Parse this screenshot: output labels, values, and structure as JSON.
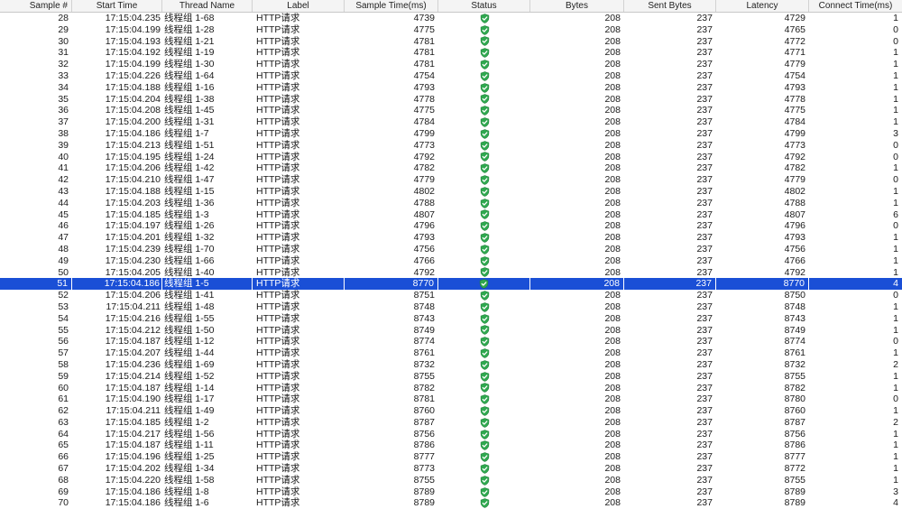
{
  "columns": {
    "sample": "Sample #",
    "start_time": "Start Time",
    "thread_name": "Thread Name",
    "label": "Label",
    "sample_time": "Sample Time(ms)",
    "status": "Status",
    "bytes": "Bytes",
    "sent_bytes": "Sent Bytes",
    "latency": "Latency",
    "connect_time": "Connect Time(ms)"
  },
  "status_icon": "success-shield-icon",
  "colors": {
    "selection": "#1a4fd6",
    "status_green": "#2fa84f"
  },
  "selected_sample": "51",
  "rows": [
    {
      "sample": "28",
      "start": "17:15:04.235",
      "thread": "线程组 1-68",
      "label": "HTTP请求",
      "time": "4739",
      "bytes": "208",
      "sent": "237",
      "latency": "4729",
      "connect": "1"
    },
    {
      "sample": "29",
      "start": "17:15:04.199",
      "thread": "线程组 1-28",
      "label": "HTTP请求",
      "time": "4775",
      "bytes": "208",
      "sent": "237",
      "latency": "4765",
      "connect": "0"
    },
    {
      "sample": "30",
      "start": "17:15:04.193",
      "thread": "线程组 1-21",
      "label": "HTTP请求",
      "time": "4781",
      "bytes": "208",
      "sent": "237",
      "latency": "4772",
      "connect": "0"
    },
    {
      "sample": "31",
      "start": "17:15:04.192",
      "thread": "线程组 1-19",
      "label": "HTTP请求",
      "time": "4781",
      "bytes": "208",
      "sent": "237",
      "latency": "4771",
      "connect": "1"
    },
    {
      "sample": "32",
      "start": "17:15:04.199",
      "thread": "线程组 1-30",
      "label": "HTTP请求",
      "time": "4781",
      "bytes": "208",
      "sent": "237",
      "latency": "4779",
      "connect": "1"
    },
    {
      "sample": "33",
      "start": "17:15:04.226",
      "thread": "线程组 1-64",
      "label": "HTTP请求",
      "time": "4754",
      "bytes": "208",
      "sent": "237",
      "latency": "4754",
      "connect": "1"
    },
    {
      "sample": "34",
      "start": "17:15:04.188",
      "thread": "线程组 1-16",
      "label": "HTTP请求",
      "time": "4793",
      "bytes": "208",
      "sent": "237",
      "latency": "4793",
      "connect": "1"
    },
    {
      "sample": "35",
      "start": "17:15:04.204",
      "thread": "线程组 1-38",
      "label": "HTTP请求",
      "time": "4778",
      "bytes": "208",
      "sent": "237",
      "latency": "4778",
      "connect": "1"
    },
    {
      "sample": "36",
      "start": "17:15:04.208",
      "thread": "线程组 1-45",
      "label": "HTTP请求",
      "time": "4775",
      "bytes": "208",
      "sent": "237",
      "latency": "4775",
      "connect": "1"
    },
    {
      "sample": "37",
      "start": "17:15:04.200",
      "thread": "线程组 1-31",
      "label": "HTTP请求",
      "time": "4784",
      "bytes": "208",
      "sent": "237",
      "latency": "4784",
      "connect": "1"
    },
    {
      "sample": "38",
      "start": "17:15:04.186",
      "thread": "线程组 1-7",
      "label": "HTTP请求",
      "time": "4799",
      "bytes": "208",
      "sent": "237",
      "latency": "4799",
      "connect": "3"
    },
    {
      "sample": "39",
      "start": "17:15:04.213",
      "thread": "线程组 1-51",
      "label": "HTTP请求",
      "time": "4773",
      "bytes": "208",
      "sent": "237",
      "latency": "4773",
      "connect": "0"
    },
    {
      "sample": "40",
      "start": "17:15:04.195",
      "thread": "线程组 1-24",
      "label": "HTTP请求",
      "time": "4792",
      "bytes": "208",
      "sent": "237",
      "latency": "4792",
      "connect": "0"
    },
    {
      "sample": "41",
      "start": "17:15:04.206",
      "thread": "线程组 1-42",
      "label": "HTTP请求",
      "time": "4782",
      "bytes": "208",
      "sent": "237",
      "latency": "4782",
      "connect": "1"
    },
    {
      "sample": "42",
      "start": "17:15:04.210",
      "thread": "线程组 1-47",
      "label": "HTTP请求",
      "time": "4779",
      "bytes": "208",
      "sent": "237",
      "latency": "4779",
      "connect": "0"
    },
    {
      "sample": "43",
      "start": "17:15:04.188",
      "thread": "线程组 1-15",
      "label": "HTTP请求",
      "time": "4802",
      "bytes": "208",
      "sent": "237",
      "latency": "4802",
      "connect": "1"
    },
    {
      "sample": "44",
      "start": "17:15:04.203",
      "thread": "线程组 1-36",
      "label": "HTTP请求",
      "time": "4788",
      "bytes": "208",
      "sent": "237",
      "latency": "4788",
      "connect": "1"
    },
    {
      "sample": "45",
      "start": "17:15:04.185",
      "thread": "线程组 1-3",
      "label": "HTTP请求",
      "time": "4807",
      "bytes": "208",
      "sent": "237",
      "latency": "4807",
      "connect": "6"
    },
    {
      "sample": "46",
      "start": "17:15:04.197",
      "thread": "线程组 1-26",
      "label": "HTTP请求",
      "time": "4796",
      "bytes": "208",
      "sent": "237",
      "latency": "4796",
      "connect": "0"
    },
    {
      "sample": "47",
      "start": "17:15:04.201",
      "thread": "线程组 1-32",
      "label": "HTTP请求",
      "time": "4793",
      "bytes": "208",
      "sent": "237",
      "latency": "4793",
      "connect": "1"
    },
    {
      "sample": "48",
      "start": "17:15:04.239",
      "thread": "线程组 1-70",
      "label": "HTTP请求",
      "time": "4756",
      "bytes": "208",
      "sent": "237",
      "latency": "4756",
      "connect": "1"
    },
    {
      "sample": "49",
      "start": "17:15:04.230",
      "thread": "线程组 1-66",
      "label": "HTTP请求",
      "time": "4766",
      "bytes": "208",
      "sent": "237",
      "latency": "4766",
      "connect": "1"
    },
    {
      "sample": "50",
      "start": "17:15:04.205",
      "thread": "线程组 1-40",
      "label": "HTTP请求",
      "time": "4792",
      "bytes": "208",
      "sent": "237",
      "latency": "4792",
      "connect": "1"
    },
    {
      "sample": "51",
      "start": "17:15:04.186",
      "thread": "线程组 1-5",
      "label": "HTTP请求",
      "time": "8770",
      "bytes": "208",
      "sent": "237",
      "latency": "8770",
      "connect": "4"
    },
    {
      "sample": "52",
      "start": "17:15:04.206",
      "thread": "线程组 1-41",
      "label": "HTTP请求",
      "time": "8751",
      "bytes": "208",
      "sent": "237",
      "latency": "8750",
      "connect": "0"
    },
    {
      "sample": "53",
      "start": "17:15:04.211",
      "thread": "线程组 1-48",
      "label": "HTTP请求",
      "time": "8748",
      "bytes": "208",
      "sent": "237",
      "latency": "8748",
      "connect": "1"
    },
    {
      "sample": "54",
      "start": "17:15:04.216",
      "thread": "线程组 1-55",
      "label": "HTTP请求",
      "time": "8743",
      "bytes": "208",
      "sent": "237",
      "latency": "8743",
      "connect": "1"
    },
    {
      "sample": "55",
      "start": "17:15:04.212",
      "thread": "线程组 1-50",
      "label": "HTTP请求",
      "time": "8749",
      "bytes": "208",
      "sent": "237",
      "latency": "8749",
      "connect": "1"
    },
    {
      "sample": "56",
      "start": "17:15:04.187",
      "thread": "线程组 1-12",
      "label": "HTTP请求",
      "time": "8774",
      "bytes": "208",
      "sent": "237",
      "latency": "8774",
      "connect": "0"
    },
    {
      "sample": "57",
      "start": "17:15:04.207",
      "thread": "线程组 1-44",
      "label": "HTTP请求",
      "time": "8761",
      "bytes": "208",
      "sent": "237",
      "latency": "8761",
      "connect": "1"
    },
    {
      "sample": "58",
      "start": "17:15:04.236",
      "thread": "线程组 1-69",
      "label": "HTTP请求",
      "time": "8732",
      "bytes": "208",
      "sent": "237",
      "latency": "8732",
      "connect": "2"
    },
    {
      "sample": "59",
      "start": "17:15:04.214",
      "thread": "线程组 1-52",
      "label": "HTTP请求",
      "time": "8755",
      "bytes": "208",
      "sent": "237",
      "latency": "8755",
      "connect": "1"
    },
    {
      "sample": "60",
      "start": "17:15:04.187",
      "thread": "线程组 1-14",
      "label": "HTTP请求",
      "time": "8782",
      "bytes": "208",
      "sent": "237",
      "latency": "8782",
      "connect": "1"
    },
    {
      "sample": "61",
      "start": "17:15:04.190",
      "thread": "线程组 1-17",
      "label": "HTTP请求",
      "time": "8781",
      "bytes": "208",
      "sent": "237",
      "latency": "8780",
      "connect": "0"
    },
    {
      "sample": "62",
      "start": "17:15:04.211",
      "thread": "线程组 1-49",
      "label": "HTTP请求",
      "time": "8760",
      "bytes": "208",
      "sent": "237",
      "latency": "8760",
      "connect": "1"
    },
    {
      "sample": "63",
      "start": "17:15:04.185",
      "thread": "线程组 1-2",
      "label": "HTTP请求",
      "time": "8787",
      "bytes": "208",
      "sent": "237",
      "latency": "8787",
      "connect": "2"
    },
    {
      "sample": "64",
      "start": "17:15:04.217",
      "thread": "线程组 1-56",
      "label": "HTTP请求",
      "time": "8756",
      "bytes": "208",
      "sent": "237",
      "latency": "8756",
      "connect": "1"
    },
    {
      "sample": "65",
      "start": "17:15:04.187",
      "thread": "线程组 1-11",
      "label": "HTTP请求",
      "time": "8786",
      "bytes": "208",
      "sent": "237",
      "latency": "8786",
      "connect": "1"
    },
    {
      "sample": "66",
      "start": "17:15:04.196",
      "thread": "线程组 1-25",
      "label": "HTTP请求",
      "time": "8777",
      "bytes": "208",
      "sent": "237",
      "latency": "8777",
      "connect": "1"
    },
    {
      "sample": "67",
      "start": "17:15:04.202",
      "thread": "线程组 1-34",
      "label": "HTTP请求",
      "time": "8773",
      "bytes": "208",
      "sent": "237",
      "latency": "8772",
      "connect": "1"
    },
    {
      "sample": "68",
      "start": "17:15:04.220",
      "thread": "线程组 1-58",
      "label": "HTTP请求",
      "time": "8755",
      "bytes": "208",
      "sent": "237",
      "latency": "8755",
      "connect": "1"
    },
    {
      "sample": "69",
      "start": "17:15:04.186",
      "thread": "线程组 1-8",
      "label": "HTTP请求",
      "time": "8789",
      "bytes": "208",
      "sent": "237",
      "latency": "8789",
      "connect": "3"
    },
    {
      "sample": "70",
      "start": "17:15:04.186",
      "thread": "线程组 1-6",
      "label": "HTTP请求",
      "time": "8789",
      "bytes": "208",
      "sent": "237",
      "latency": "8789",
      "connect": "4"
    }
  ]
}
